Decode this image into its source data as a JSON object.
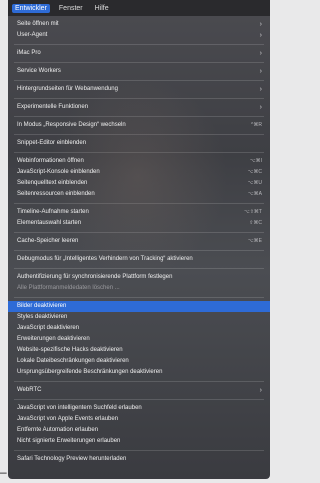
{
  "menubar": {
    "items": [
      {
        "label": "Entwickler",
        "active": true
      },
      {
        "label": "Fenster",
        "active": false
      },
      {
        "label": "Hilfe",
        "active": false
      }
    ]
  },
  "edge": {
    "right_glyph": "i",
    "bottom_glyph": "–"
  },
  "menu": {
    "groups": [
      [
        {
          "label": "Seite öffnen mit",
          "submenu": true
        },
        {
          "label": "User-Agent",
          "submenu": true
        }
      ],
      [
        {
          "label": "iMac Pro",
          "submenu": true
        }
      ],
      [
        {
          "label": "Service Workers",
          "submenu": true
        }
      ],
      [
        {
          "label": "Hintergrundseiten für Webanwendung",
          "submenu": true
        }
      ],
      [
        {
          "label": "Experimentelle Funktionen",
          "submenu": true
        }
      ],
      [
        {
          "label": "In Modus „Responsive Design“ wechseln",
          "shortcut": "^⌘R"
        }
      ],
      [
        {
          "label": "Snippet-Editor einblenden"
        }
      ],
      [
        {
          "label": "Webinformationen öffnen",
          "shortcut": "⌥⌘I"
        },
        {
          "label": "JavaScript-Konsole einblenden",
          "shortcut": "⌥⌘C"
        },
        {
          "label": "Seitenquelltext einblenden",
          "shortcut": "⌥⌘U"
        },
        {
          "label": "Seitenressourcen einblenden",
          "shortcut": "⌥⌘A"
        }
      ],
      [
        {
          "label": "Timeline-Aufnahme starten",
          "shortcut": "⌥⇧⌘T"
        },
        {
          "label": "Elementauswahl starten",
          "shortcut": "⇧⌘C"
        }
      ],
      [
        {
          "label": "Cache-Speicher leeren",
          "shortcut": "⌥⌘E"
        }
      ],
      [
        {
          "label": "Debugmodus für „Intelligentes Verhindern von Tracking“ aktivieren"
        }
      ],
      [
        {
          "label": "Authentifizierung für synchronisierende Plattform festlegen"
        },
        {
          "label": "Alle Plattformanmeldedaten löschen ...",
          "dim": true
        }
      ],
      [
        {
          "label": "Bilder deaktivieren",
          "selected": true
        },
        {
          "label": "Styles deaktivieren"
        },
        {
          "label": "JavaScript deaktivieren"
        },
        {
          "label": "Erweiterungen deaktivieren"
        },
        {
          "label": "Website-spezifische Hacks deaktivieren"
        },
        {
          "label": "Lokale Dateibeschränkungen deaktivieren"
        },
        {
          "label": "Ursprungsübergreifende Beschränkungen deaktivieren"
        }
      ],
      [
        {
          "label": "WebRTC",
          "submenu": true
        }
      ],
      [
        {
          "label": "JavaScript von intelligentem Suchfeld erlauben"
        },
        {
          "label": "JavaScript von Apple Events erlauben"
        },
        {
          "label": "Entfernte Automation erlauben"
        },
        {
          "label": "Nicht signierte Erweiterungen erlauben"
        }
      ],
      [
        {
          "label": "Safari Technology Preview herunterladen"
        }
      ]
    ]
  }
}
